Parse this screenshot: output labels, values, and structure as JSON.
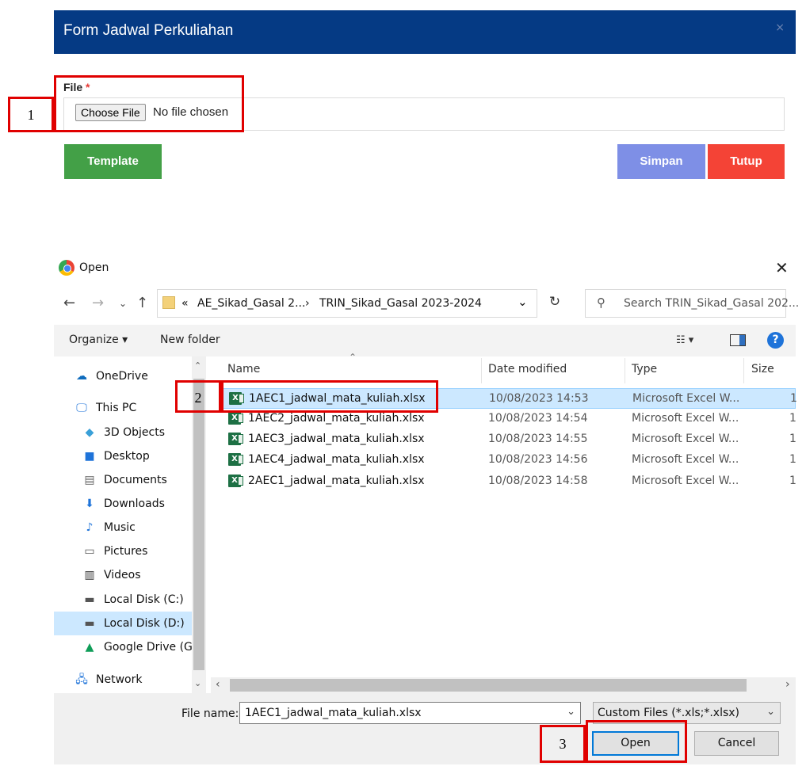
{
  "form": {
    "title": "Form Jadwal Perkuliahan",
    "close_glyph": "×",
    "file_label": "File",
    "required_mark": "*",
    "choose_file": "Choose File",
    "no_file": "No file chosen",
    "template": "Template",
    "simpan": "Simpan",
    "tutup": "Tutup"
  },
  "dialog": {
    "title": "Open",
    "close_glyph": "✕",
    "breadcrumb_prefix": "«",
    "breadcrumb": [
      "AE_Sikad_Gasal 2...",
      "TRIN_Sikad_Gasal 2023-2024"
    ],
    "breadcrumb_sep": "›",
    "search_placeholder": "Search TRIN_Sikad_Gasal 202...",
    "toolbar": {
      "organize": "Organize ▾",
      "new_folder": "New folder",
      "help": "?"
    },
    "sidebar": [
      {
        "label": "OneDrive",
        "icon": "onedrive-icon"
      },
      {
        "label": "This PC",
        "icon": "pc-icon"
      },
      {
        "label": "3D Objects",
        "icon": "3d-objects-icon"
      },
      {
        "label": "Desktop",
        "icon": "desktop-icon"
      },
      {
        "label": "Documents",
        "icon": "documents-icon"
      },
      {
        "label": "Downloads",
        "icon": "downloads-icon"
      },
      {
        "label": "Music",
        "icon": "music-icon"
      },
      {
        "label": "Pictures",
        "icon": "pictures-icon"
      },
      {
        "label": "Videos",
        "icon": "videos-icon"
      },
      {
        "label": "Local Disk (C:)",
        "icon": "drive-icon"
      },
      {
        "label": "Local Disk (D:)",
        "icon": "drive-icon"
      },
      {
        "label": "Google Drive (G:",
        "icon": "google-drive-icon"
      },
      {
        "label": "Network",
        "icon": "network-icon"
      }
    ],
    "columns": {
      "name": "Name",
      "date": "Date modified",
      "type": "Type",
      "size": "Size"
    },
    "files": [
      {
        "name": "1AEC1_jadwal_mata_kuliah.xlsx",
        "date": "10/08/2023 14:53",
        "type": "Microsoft Excel W...",
        "size": "1"
      },
      {
        "name": "1AEC2_jadwal_mata_kuliah.xlsx",
        "date": "10/08/2023 14:54",
        "type": "Microsoft Excel W...",
        "size": "1"
      },
      {
        "name": "1AEC3_jadwal_mata_kuliah.xlsx",
        "date": "10/08/2023 14:55",
        "type": "Microsoft Excel W...",
        "size": "1"
      },
      {
        "name": "1AEC4_jadwal_mata_kuliah.xlsx",
        "date": "10/08/2023 14:56",
        "type": "Microsoft Excel W...",
        "size": "1"
      },
      {
        "name": "2AEC1_jadwal_mata_kuliah.xlsx",
        "date": "10/08/2023 14:58",
        "type": "Microsoft Excel W...",
        "size": "1"
      }
    ],
    "file_name_label": "File name:",
    "file_name_value": "1AEC1_jadwal_mata_kuliah.xlsx",
    "file_type_value": "Custom Files (*.xls;*.xlsx)",
    "open": "Open",
    "cancel": "Cancel"
  },
  "annotations": {
    "step1": "1",
    "step2": "2",
    "step3": "3"
  },
  "colors": {
    "header": "#053a84",
    "template": "#43a047",
    "simpan": "#7e8fe6",
    "tutup": "#f44336",
    "annotation": "#e00000"
  }
}
